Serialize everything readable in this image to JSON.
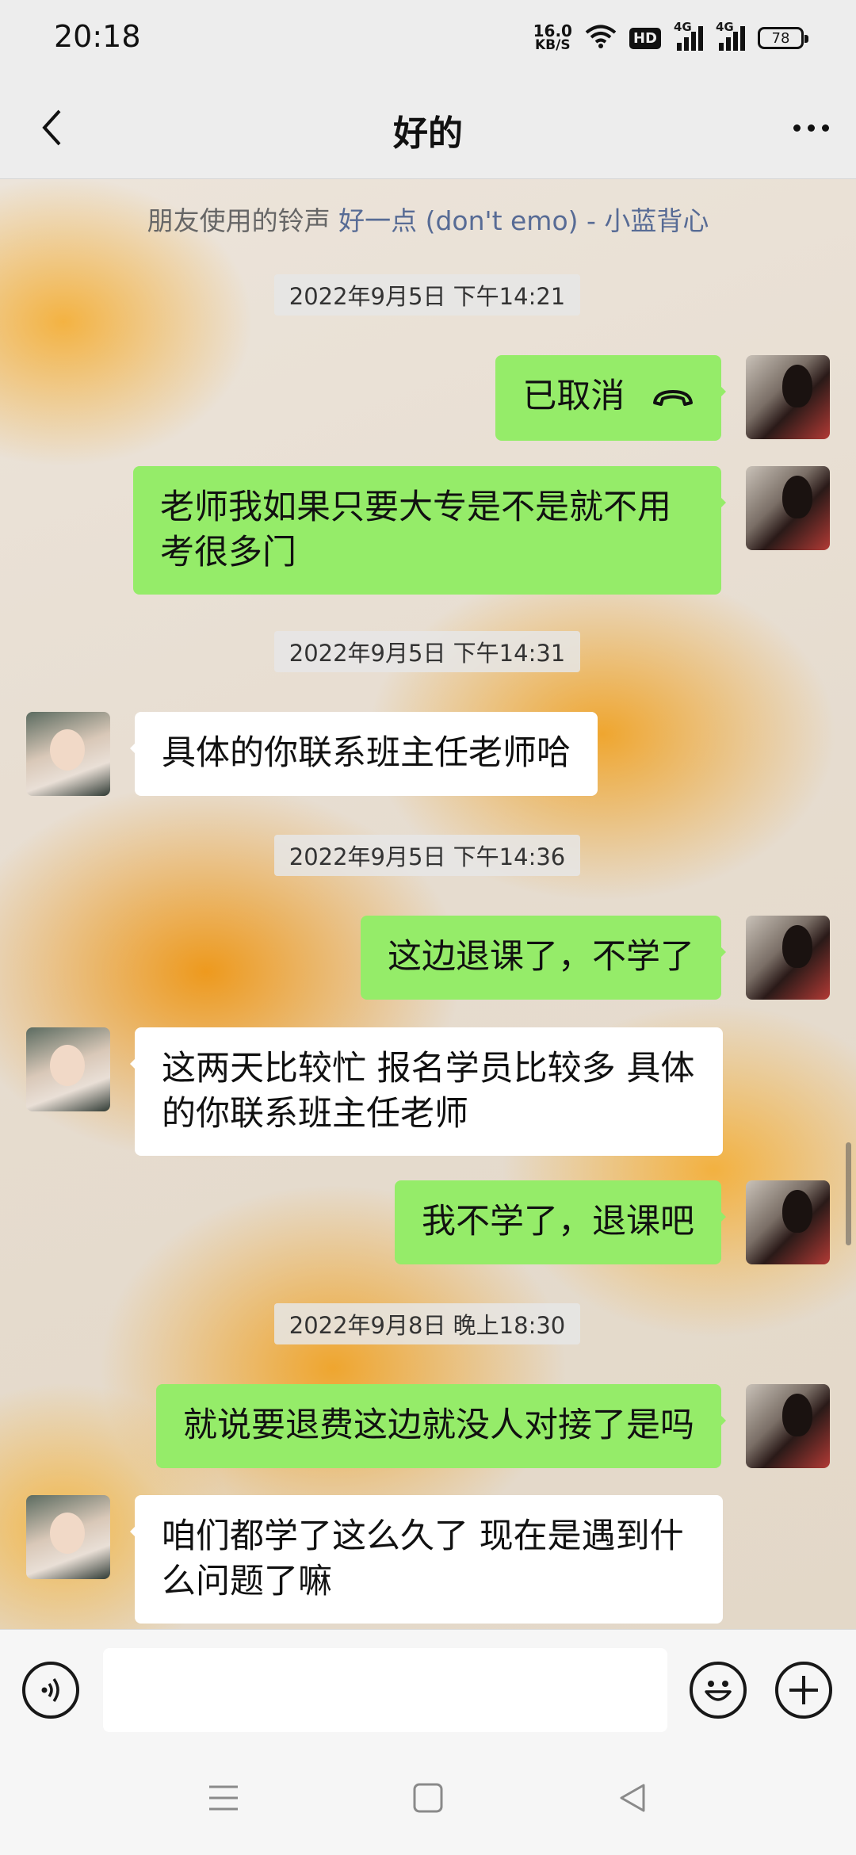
{
  "status_bar": {
    "time": "20:18",
    "net_speed_value": "16.0",
    "net_speed_unit": "KB/S",
    "hd_label": "HD",
    "signal1_label": "4G",
    "signal2_label": "4G",
    "battery": "78"
  },
  "header": {
    "title": "好的",
    "back_icon": "chevron-left-icon",
    "more_icon": "more-dots-icon"
  },
  "ringtone": {
    "prefix": "朋友使用的铃声",
    "song": "好一点 (don't emo) - 小蓝背心"
  },
  "messages": [
    {
      "type": "timestamp",
      "text": "2022年9月5日 下午14:21"
    },
    {
      "type": "sent",
      "text": "已取消",
      "icon": "call-hangup-icon"
    },
    {
      "type": "sent",
      "text": "老师我如果只要大专是不是就不用考很多门"
    },
    {
      "type": "timestamp",
      "text": "2022年9月5日 下午14:31"
    },
    {
      "type": "received",
      "text": "具体的你联系班主任老师哈"
    },
    {
      "type": "timestamp",
      "text": "2022年9月5日 下午14:36"
    },
    {
      "type": "sent",
      "text": "这边退课了，不学了"
    },
    {
      "type": "received",
      "text": "这两天比较忙 报名学员比较多 具体的你联系班主任老师"
    },
    {
      "type": "sent",
      "text": "我不学了，退课吧"
    },
    {
      "type": "timestamp",
      "text": "2022年9月8日 晚上18:30"
    },
    {
      "type": "sent",
      "text": "就说要退费这边就没人对接了是吗"
    },
    {
      "type": "received",
      "text": "咱们都学了这么久了 现在是遇到什么问题了嘛"
    }
  ],
  "input_bar": {
    "voice_icon": "voice-icon",
    "input_value": "",
    "emoji_icon": "emoji-icon",
    "plus_icon": "plus-icon"
  },
  "nav_bar": {
    "menu_icon": "menu-icon",
    "home_icon": "home-icon",
    "back_icon": "back-triangle-icon"
  },
  "colors": {
    "sent_bubble": "#95ec69",
    "received_bubble": "#ffffff",
    "link": "#576b95",
    "bar_bg": "#ededed"
  }
}
